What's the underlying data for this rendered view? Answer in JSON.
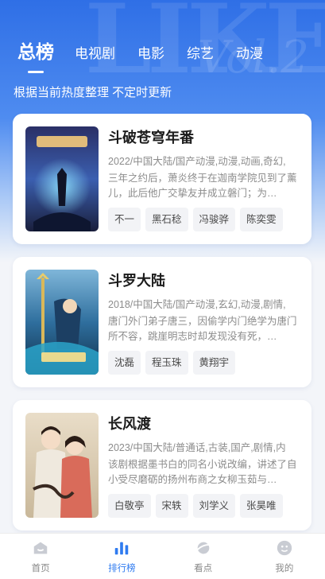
{
  "header": {
    "tabs": [
      {
        "label": "总榜",
        "active": true
      },
      {
        "label": "电视剧",
        "active": false
      },
      {
        "label": "电影",
        "active": false
      },
      {
        "label": "综艺",
        "active": false
      },
      {
        "label": "动漫",
        "active": false
      }
    ],
    "subtitle": "根据当前热度整理 不定时更新"
  },
  "items": [
    {
      "title": "斗破苍穹年番",
      "meta": "2022/中国大陆/国产动漫,动漫,动画,奇幻,",
      "desc": "三年之约后，萧炎终于在迦南学院见到了薰儿，此后他广交挚友并成立磐门；为…",
      "actors": [
        "不一",
        "黑石稔",
        "冯骏骅",
        "陈奕雯"
      ]
    },
    {
      "title": "斗罗大陆",
      "meta": "2018/中国大陆/国产动漫,玄幻,动漫,剧情,",
      "desc": "唐门外门弟子唐三，因偷学内门绝学为唐门所不容，跳崖明志时却发现没有死，…",
      "actors": [
        "沈磊",
        "程玉珠",
        "黄翔宇"
      ]
    },
    {
      "title": "长风渡",
      "meta": "2023/中国大陆/普通话,古装,国产,剧情,内",
      "desc": "该剧根据墨书白的同名小说改编，讲述了自小受尽磨砺的扬州布商之女柳玉茹与…",
      "actors": [
        "白敬亭",
        "宋轶",
        "刘学义",
        "张昊唯"
      ]
    }
  ],
  "nav": [
    {
      "label": "首页",
      "icon": "home-icon",
      "active": false
    },
    {
      "label": "排行榜",
      "icon": "ranking-icon",
      "active": true
    },
    {
      "label": "看点",
      "icon": "planet-icon",
      "active": false
    },
    {
      "label": "我的",
      "icon": "profile-icon",
      "active": false
    }
  ],
  "colors": {
    "accent": "#2f7bf0",
    "header_bg": "#2f6fe6",
    "page_bg": "#f3f5f9"
  }
}
